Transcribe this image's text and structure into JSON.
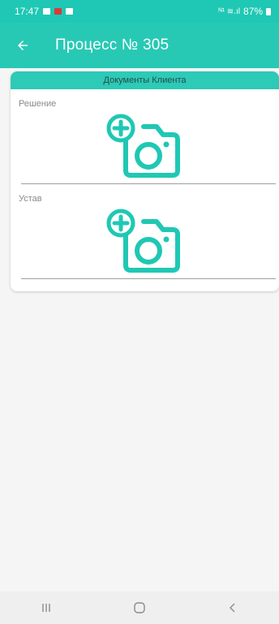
{
  "status_bar": {
    "time": "17:47",
    "signal_text": "ᴺ¹ ≋.ıl",
    "battery_percent": "87%"
  },
  "app_bar": {
    "title": "Процесс № 305",
    "back_icon": "arrow-left-icon"
  },
  "card": {
    "header": "Документы Клиента",
    "documents": [
      {
        "label": "Решение",
        "icon": "add-photo-icon"
      },
      {
        "label": "Устав",
        "icon": "add-photo-icon"
      }
    ]
  },
  "nav_bar": {
    "recents_icon": "recents-icon",
    "home_icon": "home-icon",
    "back_icon": "back-chevron-icon"
  },
  "colors": {
    "accent": "#27c9b5",
    "status_bar": "#1fc8b4",
    "card_header": "#2ccab7",
    "icon_color": "#1fc8b4"
  }
}
